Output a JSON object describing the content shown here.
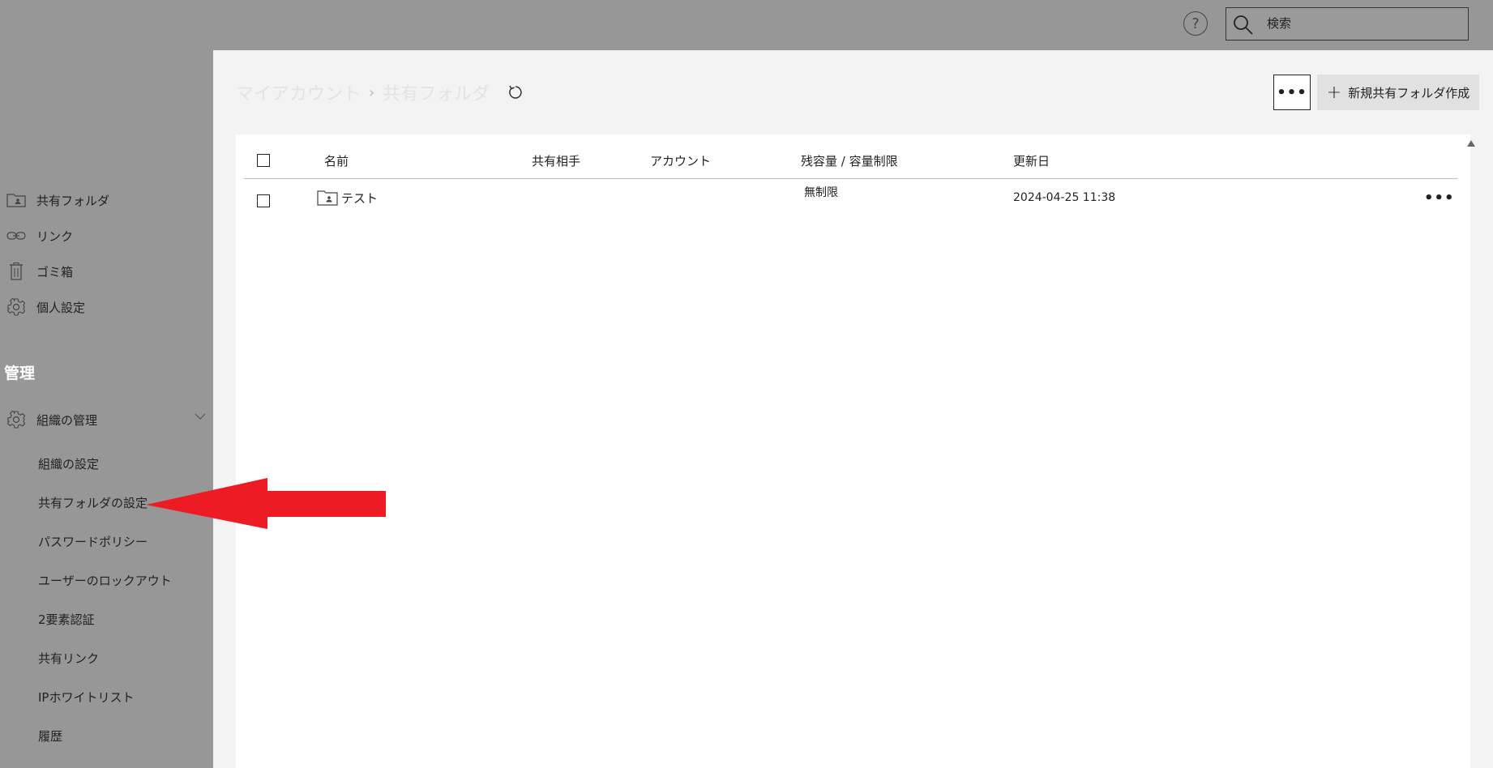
{
  "topbar": {
    "help_label": "?",
    "search_placeholder": "検索"
  },
  "sidebar": {
    "items": [
      {
        "label": "共有フォルダ",
        "icon": "shared-folder-icon"
      },
      {
        "label": "リンク",
        "icon": "link-icon"
      },
      {
        "label": "ゴミ箱",
        "icon": "trash-icon"
      },
      {
        "label": "個人設定",
        "icon": "gear-icon"
      }
    ],
    "section_title": "管理",
    "org": {
      "label": "組織の管理",
      "icon": "gear-icon"
    },
    "sub_items": [
      "組織の設定",
      "共有フォルダの設定",
      "パスワードポリシー",
      "ユーザーのロックアウト",
      "2要素認証",
      "共有リンク",
      "IPホワイトリスト",
      "履歴"
    ]
  },
  "main": {
    "breadcrumb": [
      "マイアカウント",
      "共有フォルダ"
    ],
    "breadcrumb_sep": "›",
    "more_label": "•••",
    "new_button_label": "新規共有フォルダ作成",
    "new_button_plus": "+",
    "table": {
      "columns": [
        "名前",
        "共有相手",
        "アカウント",
        "残容量 / 容量制限",
        "更新日"
      ],
      "rows": [
        {
          "name": "テスト",
          "shared_with": "",
          "account": "",
          "capacity": "無制限",
          "updated": "2024-04-25 11:38",
          "more": "•••"
        }
      ]
    }
  },
  "annotation": {
    "arrow_color": "#ed1c24"
  }
}
